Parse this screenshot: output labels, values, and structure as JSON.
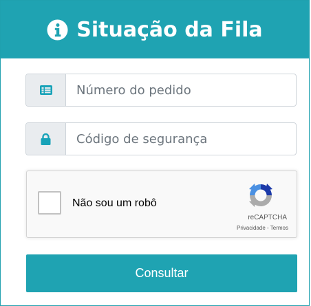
{
  "header": {
    "title": "Situação da Fila",
    "icon": "info-circle-icon",
    "background": "#1fa3b2"
  },
  "form": {
    "order_number": {
      "placeholder": "Número do pedido",
      "value": "",
      "icon": "list-card-icon"
    },
    "security_code": {
      "placeholder": "Código de segurança",
      "value": "",
      "icon": "lock-icon"
    }
  },
  "recaptcha": {
    "label": "Não sou um robô",
    "checked": false,
    "brand": "reCAPTCHA",
    "privacy_link": "Privacidade",
    "separator": " - ",
    "terms_link": "Termos",
    "icon": "recaptcha-logo-icon"
  },
  "actions": {
    "submit_label": "Consultar"
  },
  "colors": {
    "accent": "#1fa3b2",
    "icon_teal": "#17a2b8"
  }
}
